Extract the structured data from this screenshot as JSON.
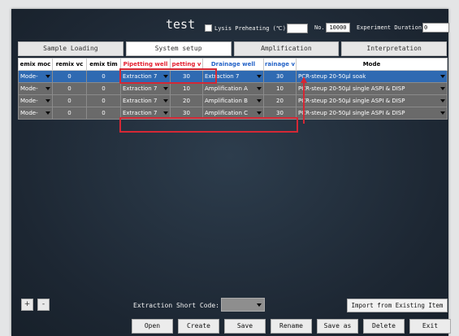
{
  "header": {
    "title": "test",
    "lysis_label": "Lysis Preheating (℃)",
    "lysis_temp_value": "",
    "no_label": "No.",
    "no_value": "10000",
    "duration_label": "Experiment Duration",
    "duration_value": "0"
  },
  "tabs": [
    {
      "label": "Sample Loading"
    },
    {
      "label": "System setup"
    },
    {
      "label": "Amplification"
    },
    {
      "label": "Interpretation"
    }
  ],
  "table": {
    "columns": [
      {
        "label": "emix moc"
      },
      {
        "label": "remix vc"
      },
      {
        "label": "emix tim"
      },
      {
        "label": "Pipetting well"
      },
      {
        "label": "petting v"
      },
      {
        "label": "Drainage well"
      },
      {
        "label": "rainage v"
      },
      {
        "label": "Mode"
      }
    ],
    "rows": [
      {
        "c0": "Mode-",
        "c1": "0",
        "c2": "0",
        "c3": "Extraction 7",
        "c4": "30",
        "c5": "Extraction 7",
        "c6": "30",
        "c7": "PCR-steup 20-50µl soak"
      },
      {
        "c0": "Mode-",
        "c1": "0",
        "c2": "0",
        "c3": "Extraction 7",
        "c4": "10",
        "c5": "Amplification A",
        "c6": "10",
        "c7": "PCR-steup 20-50µl single ASPI & DISP"
      },
      {
        "c0": "Mode-",
        "c1": "0",
        "c2": "0",
        "c3": "Extraction 7",
        "c4": "20",
        "c5": "Amplification B",
        "c6": "20",
        "c7": "PCR-steup 20-50µl single ASPI & DISP"
      },
      {
        "c0": "Mode-",
        "c1": "0",
        "c2": "0",
        "c3": "Extraction 7",
        "c4": "30",
        "c5": "Amplification C",
        "c6": "30",
        "c7": "PCR-steup 20-50µl single ASPI & DISP"
      }
    ]
  },
  "controls": {
    "add_label": "+",
    "remove_label": "-",
    "short_code_label": "Extraction Short Code:",
    "import_label": "Import from Existing Item"
  },
  "bottom_buttons": [
    {
      "label": "Open"
    },
    {
      "label": "Create"
    },
    {
      "label": "Save"
    },
    {
      "label": "Rename"
    },
    {
      "label": "Save as"
    },
    {
      "label": "Delete"
    },
    {
      "label": "Exit"
    }
  ],
  "colors": {
    "annotation_red": "#d42835",
    "selected_row": "#2f6ab2",
    "header_red": "#e31e2f",
    "header_blue": "#2463c7"
  }
}
